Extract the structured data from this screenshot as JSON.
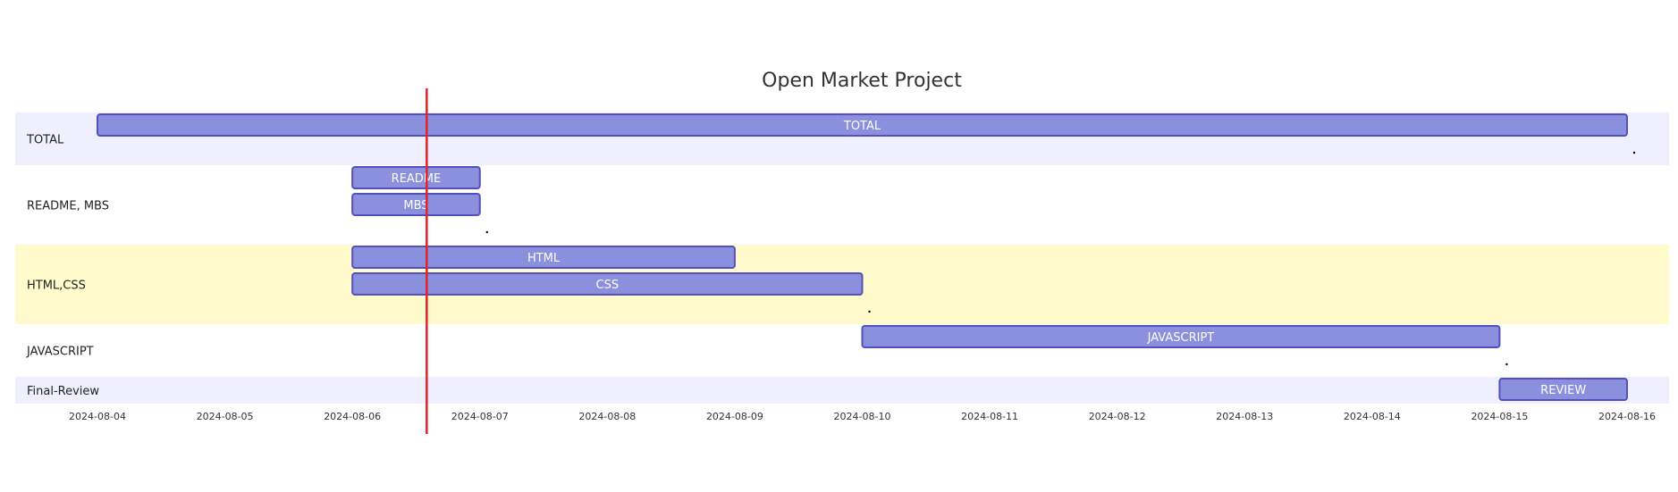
{
  "chart_data": {
    "type": "gantt",
    "title": "Open Market Project",
    "x_axis": {
      "range": [
        "2024-08-04",
        "2024-08-16"
      ],
      "ticks": [
        "2024-08-04",
        "2024-08-05",
        "2024-08-06",
        "2024-08-07",
        "2024-08-08",
        "2024-08-09",
        "2024-08-10",
        "2024-08-11",
        "2024-08-12",
        "2024-08-13",
        "2024-08-14",
        "2024-08-15",
        "2024-08-16"
      ]
    },
    "today_marker": "2024-08-06T14:00",
    "sections": [
      {
        "name": "TOTAL",
        "tasks": [
          {
            "label": "TOTAL",
            "start": "2024-08-04",
            "end": "2024-08-16"
          }
        ]
      },
      {
        "name": "README, MBS",
        "tasks": [
          {
            "label": "README",
            "start": "2024-08-06",
            "end": "2024-08-07"
          },
          {
            "label": "MBS",
            "start": "2024-08-06",
            "end": "2024-08-07"
          }
        ]
      },
      {
        "name": "HTML,CSS",
        "tasks": [
          {
            "label": "HTML",
            "start": "2024-08-06",
            "end": "2024-08-09"
          },
          {
            "label": "CSS",
            "start": "2024-08-06",
            "end": "2024-08-10"
          }
        ]
      },
      {
        "name": "JAVASCRIPT",
        "tasks": [
          {
            "label": "JAVASCRIPT",
            "start": "2024-08-10",
            "end": "2024-08-15"
          }
        ]
      },
      {
        "name": "Final-Review",
        "tasks": [
          {
            "label": "REVIEW",
            "start": "2024-08-15",
            "end": "2024-08-16"
          }
        ]
      }
    ]
  },
  "colors": {
    "bar_fill": "#8a90dd",
    "bar_stroke": "#534fbc",
    "section_band_a": "#efeffd",
    "section_band_b": "#ffffff",
    "section_band_c": "#fffbcc",
    "today_line": "#e0232a"
  }
}
